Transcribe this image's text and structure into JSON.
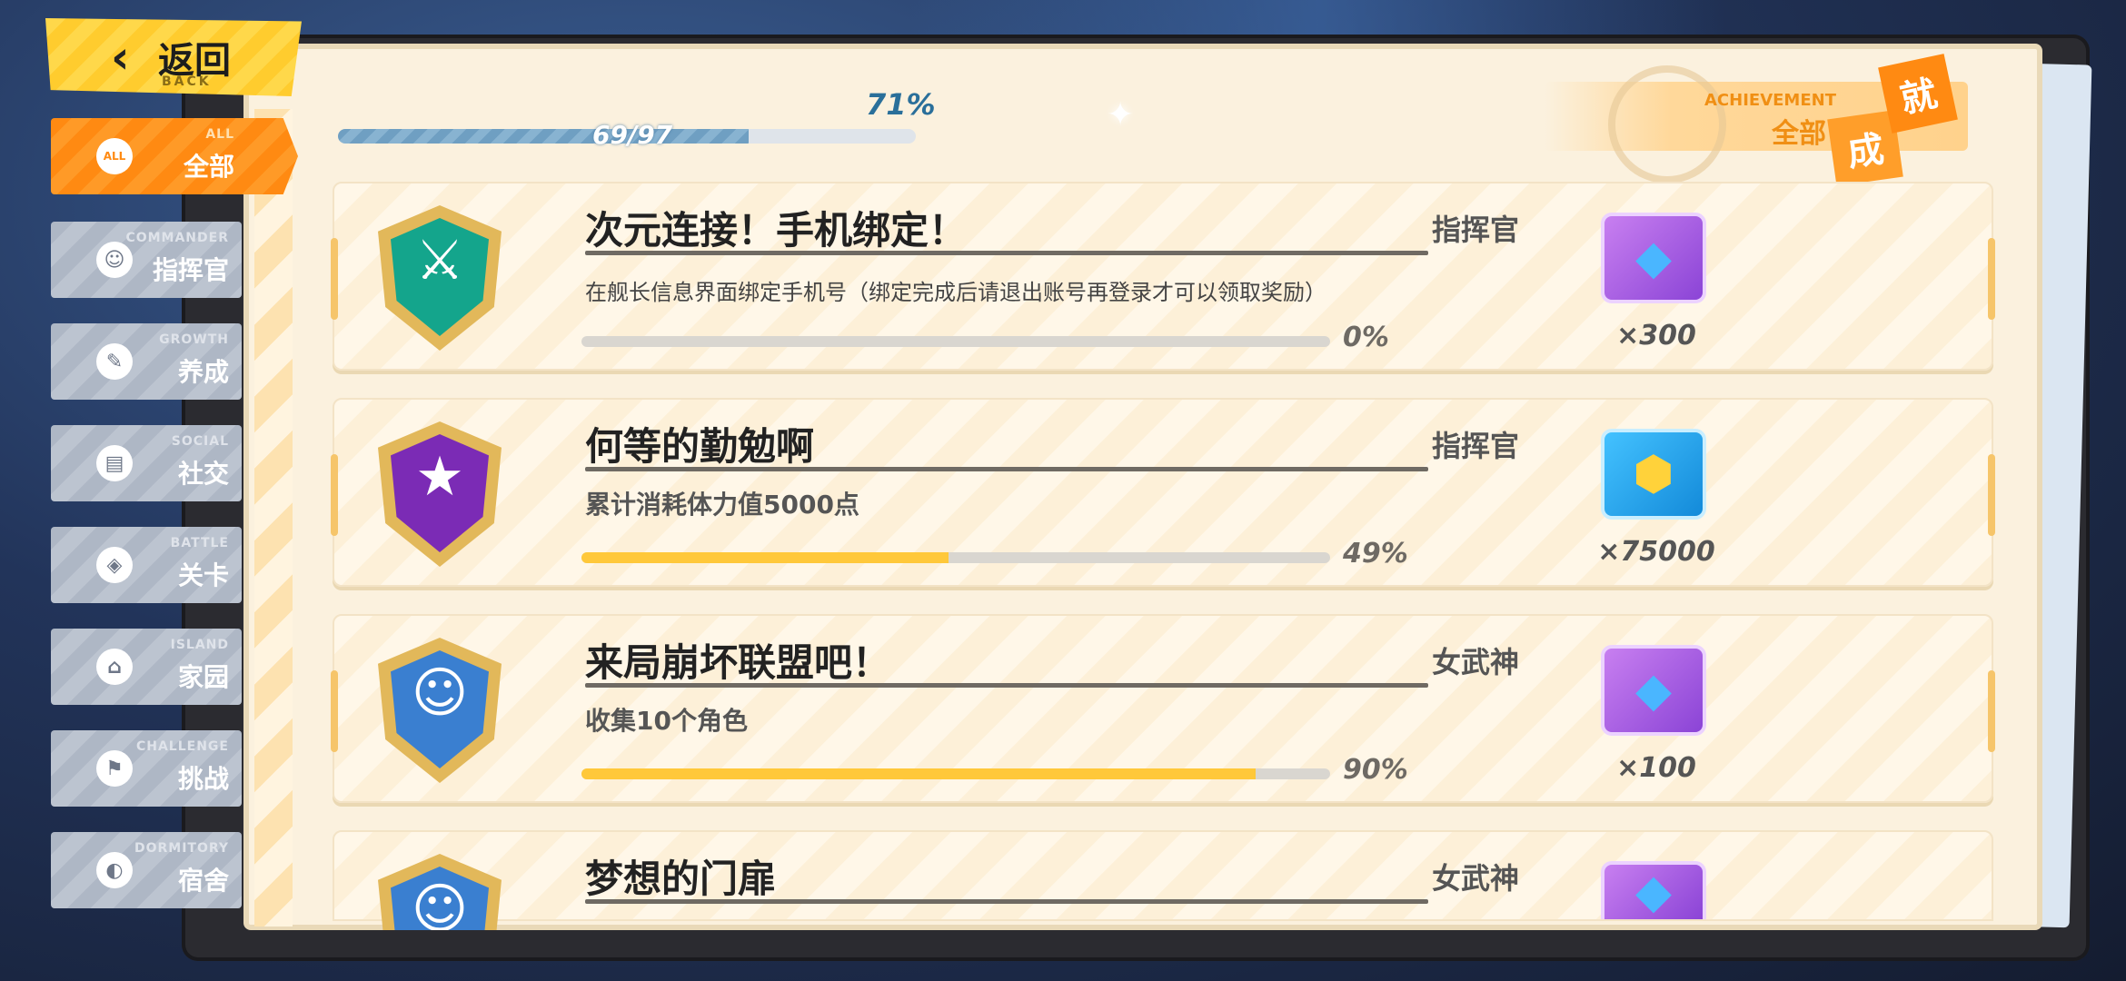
{
  "back": {
    "label": "返回",
    "sub": "BACK"
  },
  "sidebar": {
    "items": [
      {
        "en": "ALL",
        "zh": "全部",
        "icon": "ALL"
      },
      {
        "en": "COMMANDER",
        "zh": "指挥官",
        "icon": "☺"
      },
      {
        "en": "GROWTH",
        "zh": "养成",
        "icon": "✎"
      },
      {
        "en": "SOCIAL",
        "zh": "社交",
        "icon": "▤"
      },
      {
        "en": "BATTLE",
        "zh": "关卡",
        "icon": "◈"
      },
      {
        "en": "ISLAND",
        "zh": "家园",
        "icon": "⌂"
      },
      {
        "en": "CHALLENGE",
        "zh": "挑战",
        "icon": "⚑"
      },
      {
        "en": "DORMITORY",
        "zh": "宿舍",
        "icon": "◐"
      }
    ]
  },
  "progress": {
    "percent_label": "71%",
    "count": "69/97",
    "fraction": 0.711
  },
  "header": {
    "en": "ACHIEVEMENT",
    "zh": "全部",
    "tag1": "成",
    "tag2": "就"
  },
  "achievements": [
    {
      "title": "次元连接！手机绑定！",
      "category": "指挥官",
      "description": "在舰长信息界面绑定手机号（绑定完成后请退出账号再登录才可以领取奖励）",
      "percent_label": "0%",
      "progress": 0.0,
      "reward_icon": "crystal-icon",
      "reward_count": "×300"
    },
    {
      "title": "何等的勤勉啊",
      "category": "指挥官",
      "description": "累计消耗体力值5000点",
      "percent_label": "49%",
      "progress": 0.49,
      "reward_icon": "coin-icon",
      "reward_count": "×75000"
    },
    {
      "title": "来局崩坏联盟吧！",
      "category": "女武神",
      "description": "收集10个角色",
      "percent_label": "90%",
      "progress": 0.9,
      "reward_icon": "crystal-icon",
      "reward_count": "×100"
    },
    {
      "title": "梦想的门扉",
      "category": "女武神",
      "description": "",
      "percent_label": "",
      "progress": 0.0,
      "reward_icon": "crystal-icon",
      "reward_count": ""
    }
  ],
  "colors": {
    "accent": "#ff8a12",
    "progress_fill": "#ffc83a",
    "back_yellow": "#ffd84a"
  }
}
